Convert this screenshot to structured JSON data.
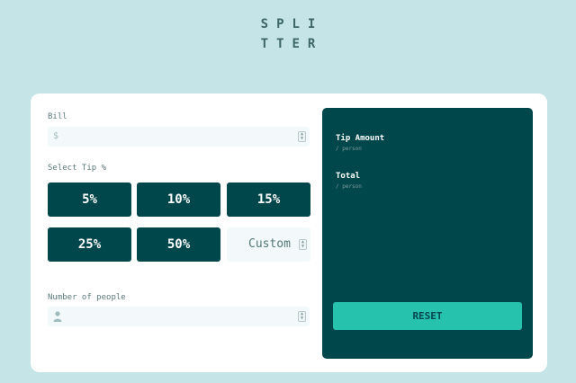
{
  "logo": {
    "line1": "SPLI",
    "line2": "TTER"
  },
  "bill": {
    "label": "Bill",
    "icon": "dollar-icon",
    "icon_glyph": "$",
    "value": ""
  },
  "tip": {
    "label": "Select Tip %",
    "options": [
      "5%",
      "10%",
      "15%",
      "25%",
      "50%"
    ],
    "custom_placeholder": "Custom"
  },
  "people": {
    "label": "Number of people",
    "icon": "person-icon",
    "value": ""
  },
  "results": {
    "tip_amount_label": "Tip Amount",
    "tip_amount_sub": "/ person",
    "total_label": "Total",
    "total_sub": "/ person",
    "reset_label": "RESET"
  },
  "colors": {
    "background": "#c5e4e7",
    "card": "#ffffff",
    "dark_cyan": "#00474b",
    "accent": "#26c2ae",
    "input_bg": "#f3f9fa"
  }
}
